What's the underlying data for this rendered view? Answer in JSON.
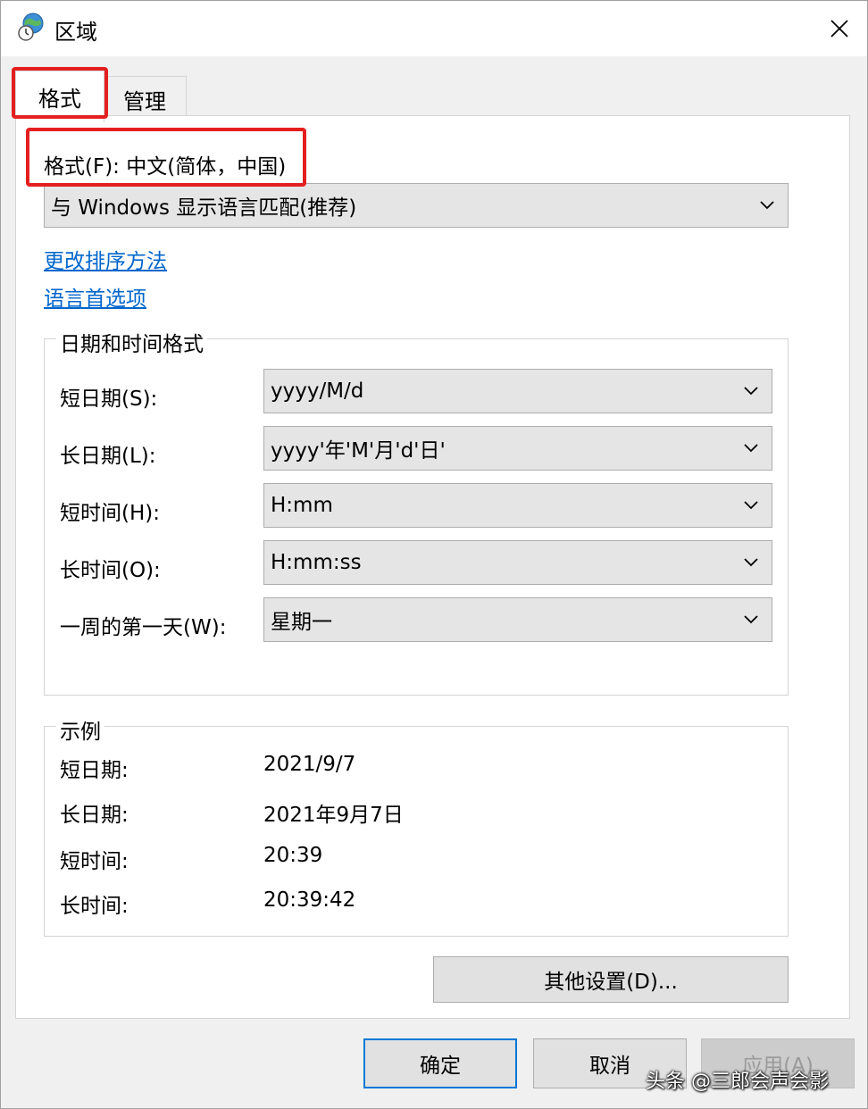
{
  "window": {
    "title": "区域"
  },
  "tabs": [
    {
      "label": "格式"
    },
    {
      "label": "管理"
    }
  ],
  "format": {
    "label": "格式(F): 中文(简体，中国)",
    "combo_value": "与 Windows 显示语言匹配(推荐)"
  },
  "links": {
    "change_sort": "更改排序方法",
    "language_prefs": "语言首选项"
  },
  "datetime_group": {
    "legend": "日期和时间格式",
    "rows": [
      {
        "label": "短日期(S):",
        "value": "yyyy/M/d"
      },
      {
        "label": "长日期(L):",
        "value": "yyyy'年'M'月'd'日'"
      },
      {
        "label": "短时间(H):",
        "value": "H:mm"
      },
      {
        "label": "长时间(O):",
        "value": "H:mm:ss"
      },
      {
        "label": "一周的第一天(W):",
        "value": "星期一"
      }
    ]
  },
  "example_group": {
    "legend": "示例",
    "rows": [
      {
        "label": "短日期:",
        "value": "2021/9/7"
      },
      {
        "label": "长日期:",
        "value": "2021年9月7日"
      },
      {
        "label": "短时间:",
        "value": "20:39"
      },
      {
        "label": "长时间:",
        "value": "20:39:42"
      }
    ]
  },
  "buttons": {
    "other_settings": "其他设置(D)...",
    "ok": "确定",
    "cancel": "取消",
    "apply": "应用(A)"
  },
  "watermark": "头条 @三郎会声会影",
  "colors": {
    "highlight": "#e41f1f",
    "link": "#0066cc",
    "focus": "#0078d7"
  }
}
